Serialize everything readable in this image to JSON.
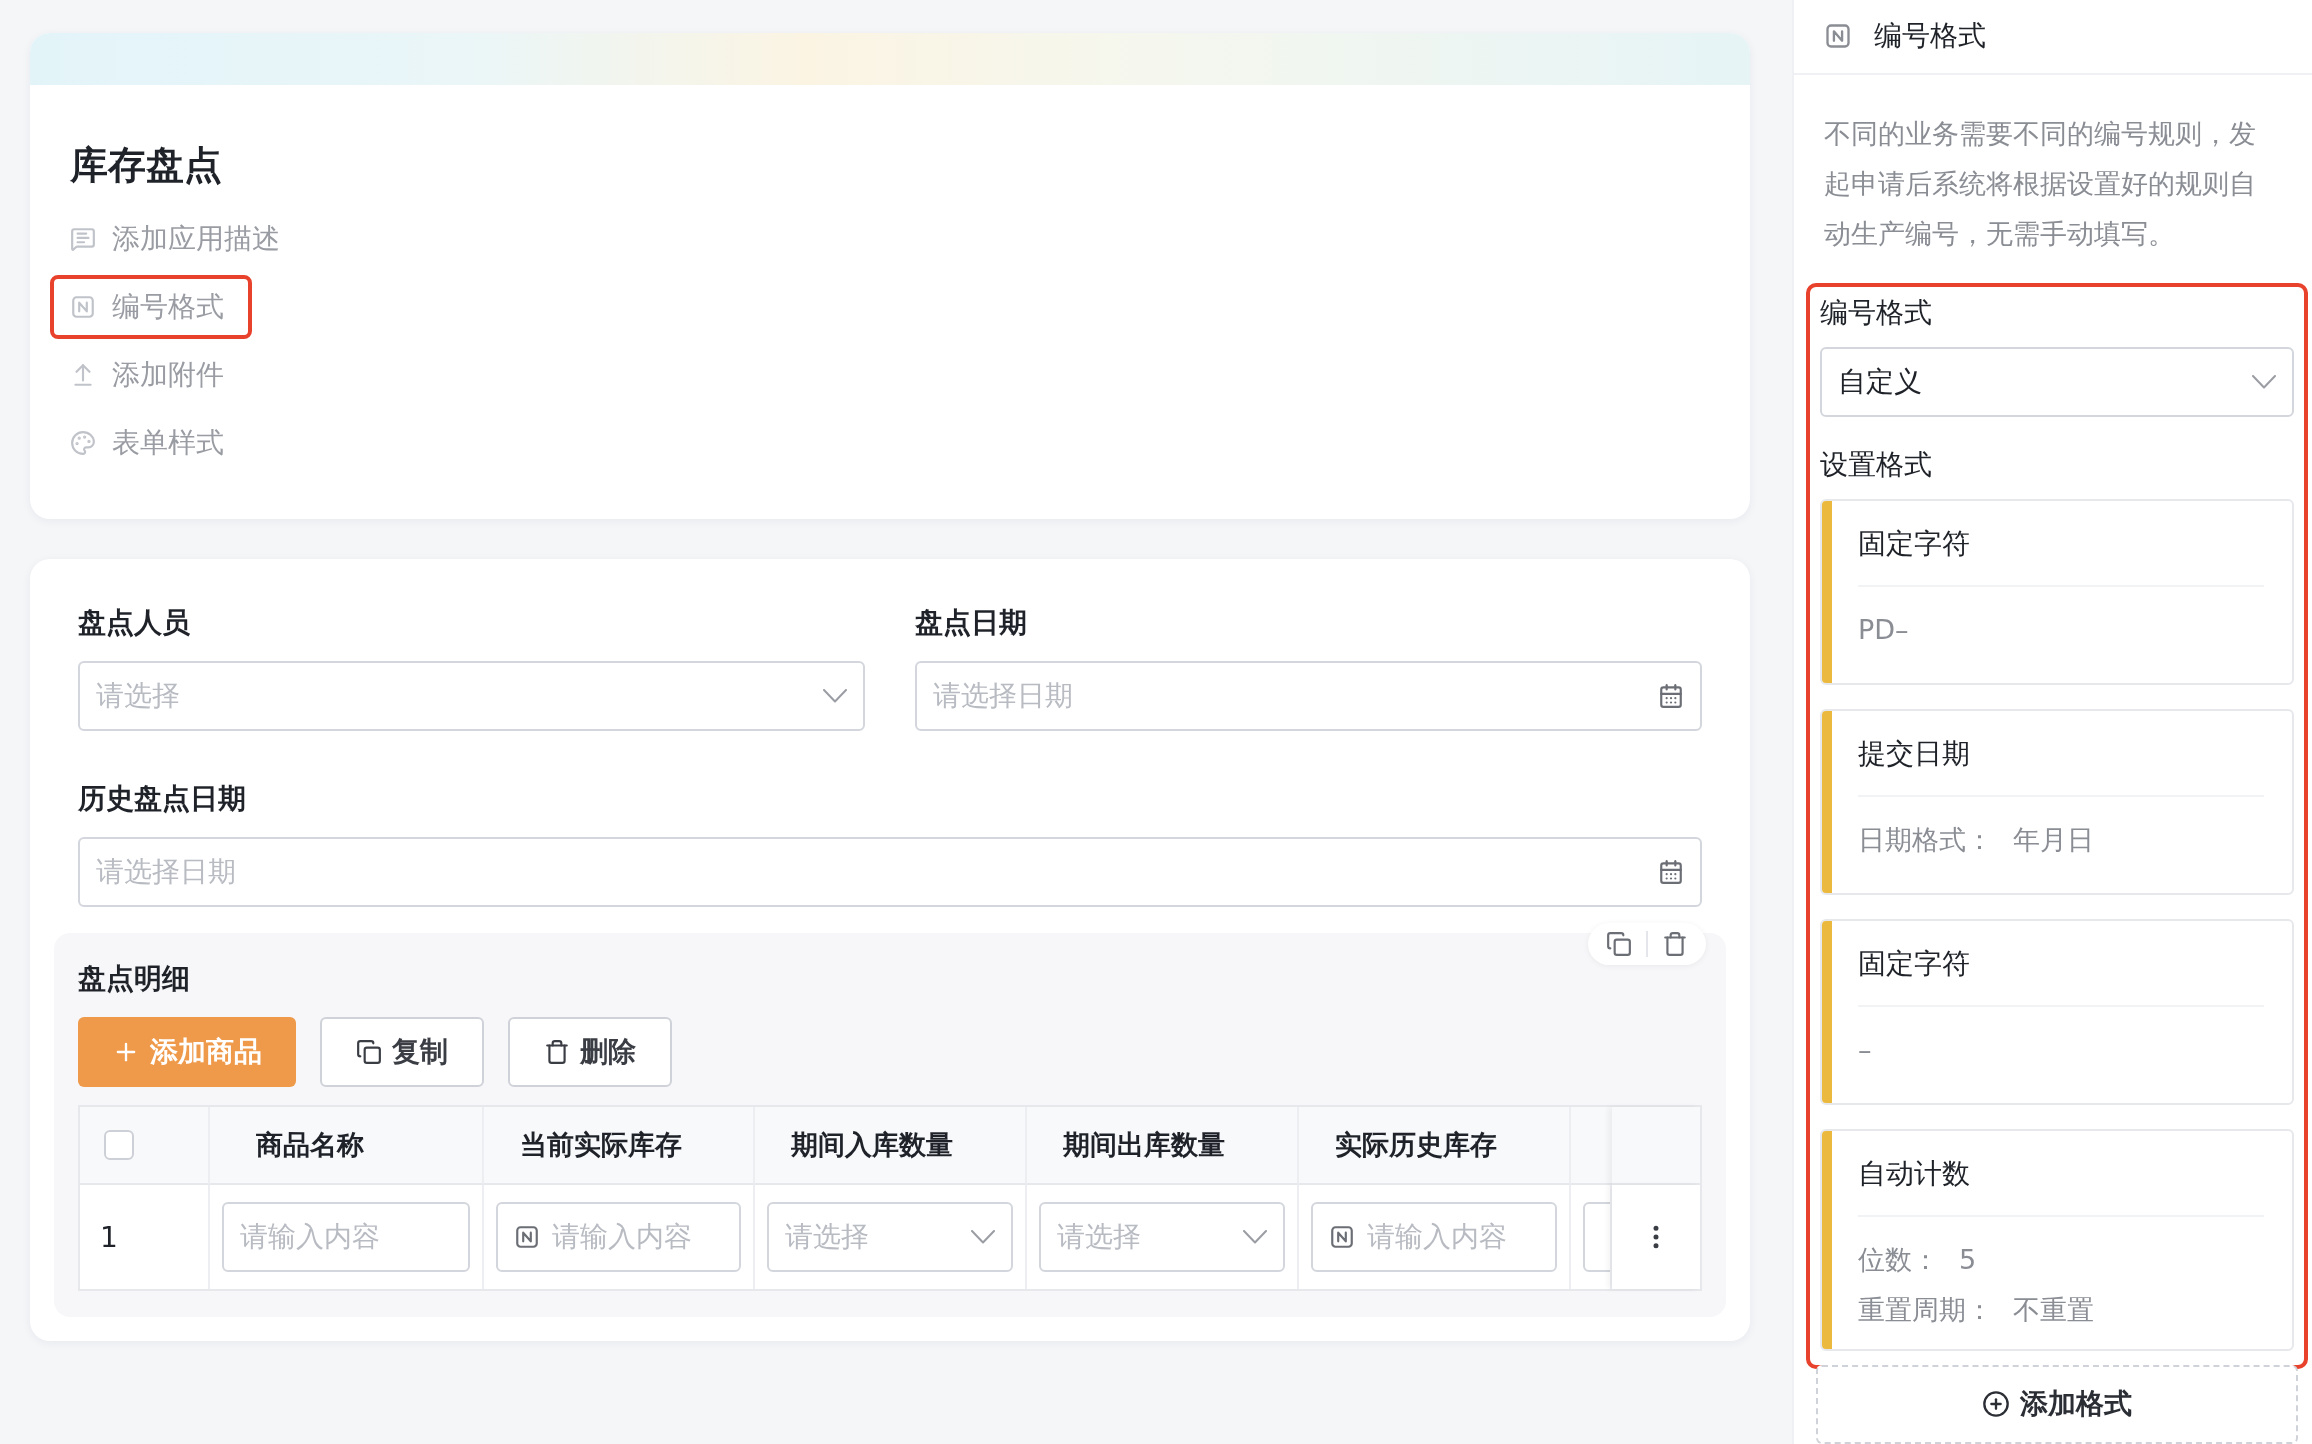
{
  "app": {
    "title": "库存盘点",
    "nav": [
      {
        "kind": "comment",
        "label": "添加应用描述",
        "highlighted": false
      },
      {
        "kind": "number",
        "label": "编号格式",
        "highlighted": true
      },
      {
        "kind": "upload",
        "label": "添加附件",
        "highlighted": false
      },
      {
        "kind": "palette",
        "label": "表单样式",
        "highlighted": false
      }
    ]
  },
  "form": {
    "fields": [
      {
        "label": "盘点人员",
        "kind": "select",
        "placeholder": "请选择"
      },
      {
        "label": "盘点日期",
        "kind": "date",
        "placeholder": "请选择日期"
      },
      {
        "label": "历史盘点日期",
        "kind": "date",
        "placeholder": "请选择日期"
      }
    ]
  },
  "detail": {
    "title": "盘点明细",
    "buttons": [
      {
        "label": "添加商品",
        "kind": "primary"
      },
      {
        "label": "复制",
        "kind": "copy"
      },
      {
        "label": "删除",
        "kind": "delete"
      }
    ],
    "table": {
      "select_all": {
        "checked": false
      },
      "columns": [
        "商品名称",
        "当前实际库存",
        "期间入库数量",
        "期间出库数量",
        "实际历史库存"
      ],
      "rows": [
        {
          "number": "1",
          "cells": [
            {
              "kind": "text",
              "placeholder": "请输入内容"
            },
            {
              "kind": "number",
              "placeholder": "请输入内容"
            },
            {
              "kind": "select",
              "placeholder": "请选择"
            },
            {
              "kind": "select",
              "placeholder": "请选择"
            },
            {
              "kind": "number",
              "placeholder": "请输入内容"
            }
          ]
        }
      ]
    }
  },
  "number_panel": {
    "title": "编号格式",
    "description": "不同的业务需要不同的编号规则，发起申请后系统将根据设置好的规则自动生产编号，无需手动填写。",
    "highlighted": true,
    "format_label": "编号格式",
    "format_value": "自定义",
    "segments_label": "设置格式",
    "segments": [
      {
        "title": "固定字符",
        "lines": [
          {
            "value": "PD–"
          }
        ]
      },
      {
        "title": "提交日期",
        "lines": [
          {
            "label": "日期格式：",
            "value": "年月日"
          }
        ]
      },
      {
        "title": "固定字符",
        "lines": [
          {
            "value": "–"
          }
        ]
      },
      {
        "title": "自动计数",
        "lines": [
          {
            "label": "位数：",
            "value": "5"
          },
          {
            "label": "重置周期：",
            "value": "不重置"
          }
        ]
      }
    ],
    "add_button": "添加格式"
  }
}
